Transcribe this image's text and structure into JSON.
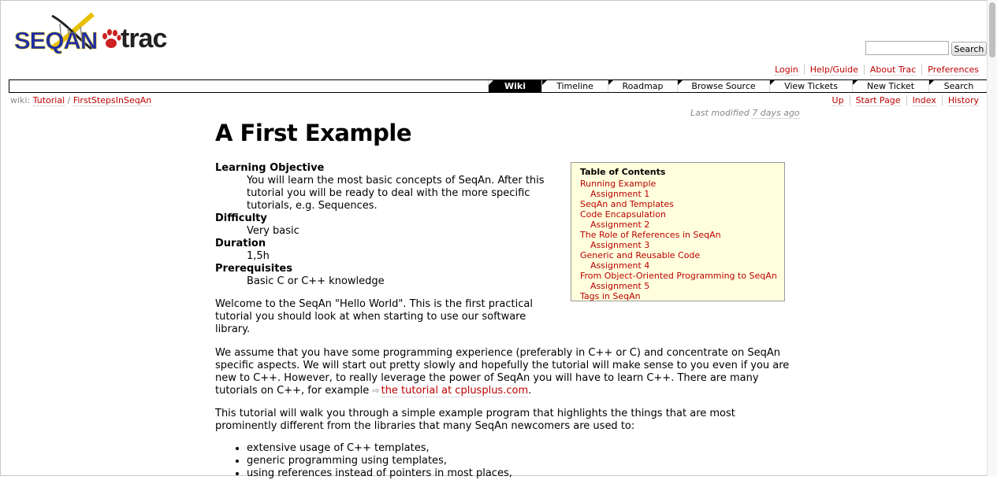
{
  "logo": {
    "seqan": "SEQAN",
    "trac": "trac"
  },
  "search": {
    "placeholder": "",
    "button": "Search"
  },
  "metanav": [
    "Login",
    "Help/Guide",
    "About Trac",
    "Preferences"
  ],
  "mainnav": {
    "tabs": [
      "Wiki",
      "Timeline",
      "Roadmap",
      "Browse Source",
      "View Tickets",
      "New Ticket",
      "Search"
    ],
    "active": "Wiki"
  },
  "ctxnav": {
    "prefix": "wiki:",
    "path": [
      "Tutorial",
      "FirstStepsInSeqAn"
    ],
    "sep": " / ",
    "links": [
      "Up",
      "Start Page",
      "Index",
      "History"
    ]
  },
  "lastmod": {
    "prefix": "Last modified ",
    "ago": "7 days ago"
  },
  "page": {
    "title": "A First Example",
    "defs": [
      {
        "term": "Learning Objective",
        "desc": "You will learn the most basic concepts of SeqAn. After this tutorial you will be ready to deal with the more specific tutorials, e.g. Sequences."
      },
      {
        "term": "Difficulty",
        "desc": "Very basic"
      },
      {
        "term": "Duration",
        "desc": "1,5h"
      },
      {
        "term": "Prerequisites",
        "desc": "Basic C or C++ knowledge"
      }
    ],
    "p1": "Welcome to the SeqAn \"Hello World\". This is the first practical tutorial you should look at when starting to use our software library.",
    "p2_text": "We assume that you have some programming experience (preferably in C++ or C) and concentrate on SeqAn specific aspects. We will start out pretty slowly and hopefully the tutorial will make sense to you even if you are new to C++. However, to really leverage the power of SeqAn you will have to learn C++. There are many tutorials on C++, for example ",
    "p2_link": "the tutorial at cplusplus.com",
    "p2_end": ".",
    "p3": "This tutorial will walk you through a simple example program that highlights the things that are most prominently different from the libraries that many SeqAn newcomers are used to:",
    "bullets": [
      "extensive usage of C++ templates,",
      "generic programming using templates,",
      "using references instead of pointers in most places,"
    ]
  },
  "toc": {
    "title": "Table of Contents",
    "items": [
      {
        "label": "Running Example",
        "level": 1
      },
      {
        "label": "Assignment 1",
        "level": 2
      },
      {
        "label": "SeqAn and Templates",
        "level": 1
      },
      {
        "label": "Code Encapsulation",
        "level": 1
      },
      {
        "label": "Assignment 2",
        "level": 2
      },
      {
        "label": "The Role of References in SeqAn",
        "level": 1
      },
      {
        "label": "Assignment 3",
        "level": 2
      },
      {
        "label": "Generic and Reusable Code",
        "level": 1
      },
      {
        "label": "Assignment 4",
        "level": 2
      },
      {
        "label": "From Object-Oriented Programming to SeqAn",
        "level": 1
      },
      {
        "label": "Assignment 5",
        "level": 2
      },
      {
        "label": "Tags in SeqAn",
        "level": 1
      }
    ]
  },
  "colors": {
    "link": "#bb0000",
    "toc_bg": "#ffffdd",
    "nav_active": "#000000",
    "logo_blue": "#1f2fa6",
    "logo_yellow": "#e8c000",
    "paw_red": "#cc2222"
  }
}
